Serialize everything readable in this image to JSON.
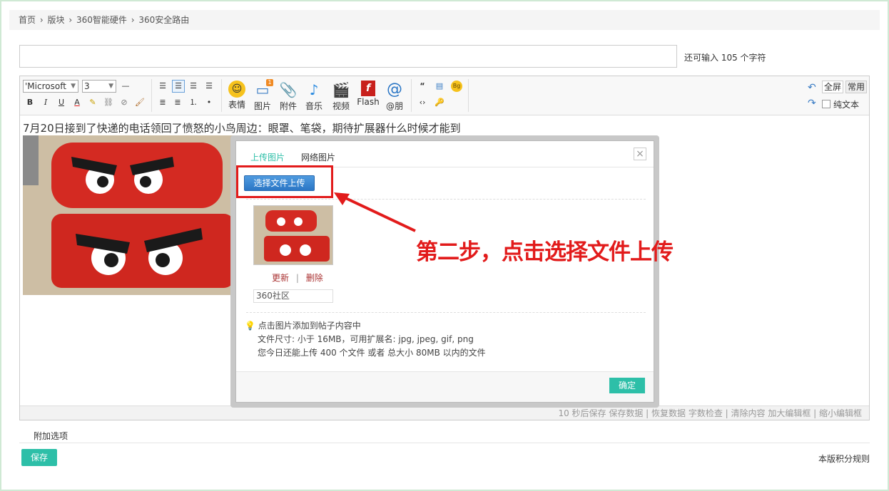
{
  "breadcrumb": [
    "首页",
    "版块",
    "360智能硬件",
    "360安全路由"
  ],
  "breadcrumb_sep": "›",
  "title_hint": "还可输入 105 个字符",
  "toolbar": {
    "font": "'Microsoft",
    "size": "3",
    "buttons": {
      "emoji": "表情",
      "image": "图片",
      "attach": "附件",
      "music": "音乐",
      "video": "视频",
      "flash": "Flash",
      "at": "@朋"
    },
    "image_badge": "1",
    "fullscreen": "全屏",
    "common": "常用",
    "plain_text": "纯文本"
  },
  "post_text": "7月20日接到了快递的电话领回了愤怒的小鸟周边：眼罩、笔袋，期待扩展器什么时候才能到",
  "status_bar": "10 秒后保存 保存数据 | 恢复数据    字数检查 | 清除内容    加大编辑框 | 缩小编辑框",
  "dialog": {
    "tab_upload": "上传图片",
    "tab_web": "网络图片",
    "close": "×",
    "choose_file": "选择文件上传",
    "update": "更新",
    "delete": "删除",
    "link_sep": "|",
    "image_name": "360社区",
    "tip1": "点击图片添加到帖子内容中",
    "tip2": "文件尺寸: 小于 16MB，可用扩展名: jpg, jpeg, gif, png",
    "tip3": "您今日还能上传 400 个文件 或者 总大小 80MB 以内的文件",
    "ok": "确定"
  },
  "annotation": "第二步，点击选择文件上传",
  "extra_options": "附加选项",
  "save": "保存",
  "rules": "本版积分规则",
  "colors": {
    "accent": "#2dbfa8",
    "annotation_red": "#e21b1b",
    "upload_blue": "#2b76c5"
  }
}
